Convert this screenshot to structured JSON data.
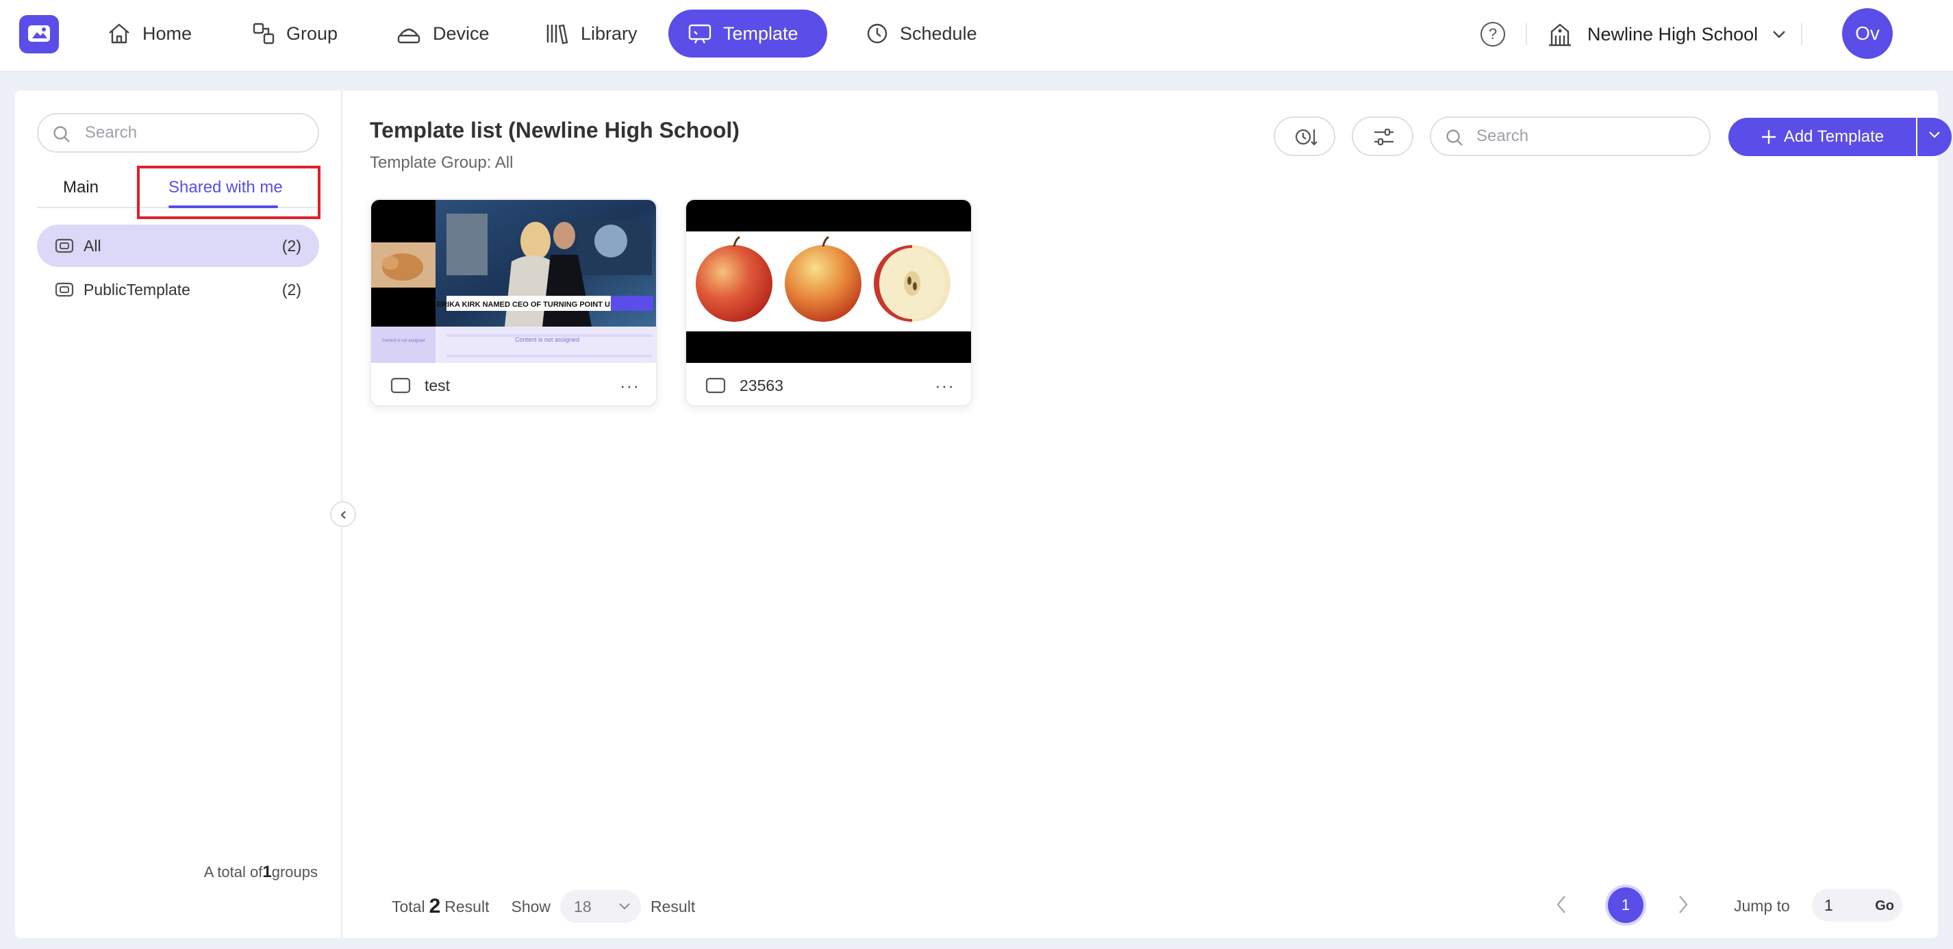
{
  "nav": {
    "items": [
      {
        "label": "Home",
        "icon": "home-icon"
      },
      {
        "label": "Group",
        "icon": "group-icon"
      },
      {
        "label": "Device",
        "icon": "device-icon"
      },
      {
        "label": "Library",
        "icon": "library-icon"
      },
      {
        "label": "Template",
        "icon": "template-icon",
        "active": true
      },
      {
        "label": "Schedule",
        "icon": "clock-icon"
      }
    ],
    "help": "?",
    "school": "Newline High School",
    "avatar": "Ov"
  },
  "sidebar": {
    "search_placeholder": "Search",
    "tabs": {
      "main": "Main",
      "shared": "Shared with me"
    },
    "groups": [
      {
        "name": "All",
        "count": "(2)"
      },
      {
        "name": "PublicTemplate",
        "count": "(2)"
      }
    ],
    "total_prefix": "A total of",
    "total_count": "1",
    "total_suffix": "groups"
  },
  "main": {
    "title": "Template list (Newline High School)",
    "group_label": "Template Group: All",
    "search_placeholder": "Search",
    "add_label": "Add Template",
    "cards": [
      {
        "name": "test",
        "banner": "ERIKA KIRK NAMED CEO OF TURNING POINT USA",
        "placeholder_small": "Content is not assigned",
        "placeholder_large": "Content is not assigned"
      },
      {
        "name": "23563"
      }
    ]
  },
  "footer": {
    "total_label": "Total",
    "total_count": "2",
    "result_label": "Result",
    "show_label": "Show",
    "show_value": "18",
    "result_label2": "Result",
    "current_page": "1",
    "jump_label": "Jump to",
    "jump_value": "1",
    "go_label": "Go"
  },
  "colors": {
    "accent": "#5a4de8",
    "highlight": "#e0202a",
    "selected_bg": "#dcd8f8"
  }
}
